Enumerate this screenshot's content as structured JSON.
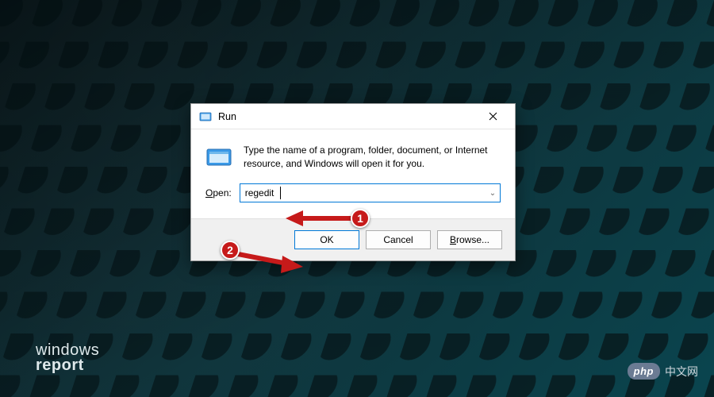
{
  "watermarks": {
    "left_line1": "windows",
    "left_line2": "report",
    "right_badge": "php",
    "right_text": "中文网"
  },
  "dialog": {
    "title": "Run",
    "description": "Type the name of a program, folder, document, or Internet resource, and Windows will open it for you.",
    "open_label_prefix": "O",
    "open_label_rest": "pen:",
    "input_value": "regedit",
    "buttons": {
      "ok": "OK",
      "cancel": "Cancel",
      "browse_prefix": "B",
      "browse_rest": "rowse..."
    }
  },
  "annotations": {
    "callout1": "1",
    "callout2": "2"
  }
}
